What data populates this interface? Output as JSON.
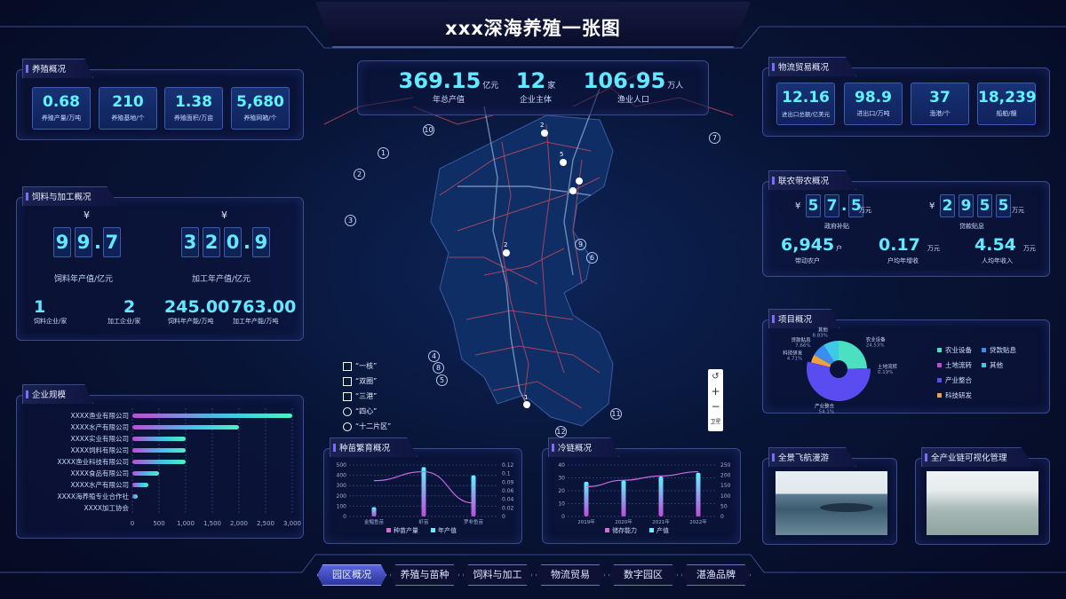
{
  "title": "xxx深海养殖一张图",
  "aquaculture": {
    "title": "养殖概况",
    "cards": [
      {
        "value": "0.68",
        "label": "养殖产量/万吨"
      },
      {
        "value": "210",
        "label": "养殖基地/个"
      },
      {
        "value": "1.38",
        "label": "养殖面积/万亩"
      },
      {
        "value": "5,680",
        "label": "养殖网箱/个"
      }
    ]
  },
  "feed": {
    "title": "饲料与加工概况",
    "currency": "¥",
    "left": {
      "digits": [
        "9",
        "9",
        ".",
        "7"
      ],
      "label": "饲料年产值/亿元"
    },
    "right": {
      "digits": [
        "3",
        "2",
        "0",
        ".",
        "9"
      ],
      "label": "加工年产值/亿元"
    },
    "stats": [
      {
        "value": "1",
        "label": "饲料企业/家"
      },
      {
        "value": "2",
        "label": "加工企业/家"
      },
      {
        "value": "245.00",
        "label": "饲料年产能/万吨"
      },
      {
        "value": "763.00",
        "label": "加工年产能/万吨"
      }
    ]
  },
  "scale": {
    "title": "企业规模"
  },
  "center": {
    "stats": [
      {
        "value": "369.15",
        "unit": "亿元",
        "label": "年总产值"
      },
      {
        "value": "12",
        "unit": "家",
        "label": "企业主体"
      },
      {
        "value": "106.95",
        "unit": "万人",
        "label": "渔业人口"
      }
    ]
  },
  "map": {
    "legend": [
      "“一核”",
      "“双圈”",
      "“三港”",
      "“四心”",
      "“十二片区”"
    ],
    "markers": [
      "1",
      "2",
      "3",
      "4",
      "5",
      "6",
      "7",
      "8",
      "9",
      "10",
      "11",
      "12"
    ],
    "pins": [
      "2",
      "5",
      "2",
      "1"
    ],
    "controls": [
      "↺",
      "+",
      "−",
      "卫星"
    ]
  },
  "logistics": {
    "title": "物流贸易概况",
    "cards": [
      {
        "value": "12.16",
        "label": "进出口总额/亿美元"
      },
      {
        "value": "98.9",
        "label": "进出口/万吨"
      },
      {
        "value": "37",
        "label": "渔港/个"
      },
      {
        "value": "18,239",
        "label": "船舶/艘"
      }
    ]
  },
  "farmers": {
    "title": "联农带农概况",
    "currency": "¥",
    "subsidy": {
      "digits": [
        "5",
        "7",
        ".",
        "5"
      ],
      "unit": "万元",
      "label": "政府补贴"
    },
    "loan": {
      "digits": [
        "2",
        "9",
        "5",
        "5"
      ],
      "unit": "万元",
      "label": "贷款贴息"
    },
    "stats": [
      {
        "value": "6,945",
        "unit": "户",
        "label": "带动农户"
      },
      {
        "value": "0.17",
        "unit": "万元",
        "label": "户均年增收"
      },
      {
        "value": "4.54",
        "unit": "万元",
        "label": "人均年收入"
      }
    ]
  },
  "project": {
    "title": "项目概况",
    "legend": [
      "农业设备",
      "贷款贴息",
      "土地流转",
      "其他",
      "产业整合",
      "科技研发"
    ]
  },
  "seedling": {
    "title": "种苗繁育概况"
  },
  "coldchain": {
    "title": "冷链概况"
  },
  "flight": {
    "title": "全景飞航漫游"
  },
  "chain": {
    "title": "全产业链可视化管理"
  },
  "nav": [
    "园区概况",
    "养殖与苗种",
    "饲料与加工",
    "物流贸易",
    "数字园区",
    "湛渔品牌"
  ],
  "colors": {
    "accent": "#63e9ff",
    "pink": "#d86ad8",
    "purple": "#7a6cff"
  },
  "chart_data": [
    {
      "type": "bar",
      "title": "企业规模",
      "orientation": "horizontal",
      "categories": [
        "XXXX渔业有限公司",
        "XXXX水产有限公司",
        "XXXX实业有限公司",
        "XXXX饲料有限公司",
        "XXXX渔业科技有限公司",
        "XXXX食品有限公司",
        "XXXX水产有限公司",
        "XXXX海养殖专业合作社",
        "XXXX加工协会"
      ],
      "values": [
        3000,
        2000,
        1000,
        1000,
        1000,
        500,
        300,
        100,
        0
      ],
      "xticks": [
        "0",
        "500",
        "1,000",
        "1,500",
        "2,000",
        "2,500",
        "3,000"
      ],
      "xlim": [
        0,
        3000
      ]
    },
    {
      "type": "pie",
      "title": "项目概况",
      "slices": [
        {
          "name": "产业整合",
          "value": 54.1,
          "label": "产业整合 54.1%",
          "color": "#5a4cf0"
        },
        {
          "name": "农业设备",
          "value": 24.53,
          "label": "农业设备 24.53%",
          "color": "#4be0c0"
        },
        {
          "name": "土地流转",
          "value": 0.19,
          "label": "土地流转 0.19%",
          "color": "#c04bd8"
        },
        {
          "name": "科技研发",
          "value": 4.71,
          "label": "科技研发 4.71%",
          "color": "#f0a040"
        },
        {
          "name": "贷款贴息",
          "value": 7.66,
          "label": "贷款贴息 7.66%",
          "color": "#3a8cf0"
        },
        {
          "name": "其他",
          "value": 8.83,
          "label": "其他 8.83%",
          "color": "#3ec9e8"
        }
      ]
    },
    {
      "type": "bar+line",
      "title": "种苗繁育概况",
      "categories": [
        "金鲳鱼苗",
        "虾苗",
        "罗非鱼苗"
      ],
      "series": [
        {
          "name": "种苗产量",
          "type": "bar",
          "values": [
            90,
            480,
            400
          ]
        },
        {
          "name": "年产值",
          "type": "line",
          "values": [
            0.08,
            0.1,
            0.03
          ]
        }
      ],
      "ylim": [
        0,
        500
      ],
      "yticks": [
        "0",
        "100",
        "200",
        "300",
        "400",
        "500"
      ],
      "y2ticks": [
        "0",
        "0.02",
        "0.04",
        "0.06",
        "0.09",
        "0.1",
        "0.12"
      ]
    },
    {
      "type": "bar+line",
      "title": "冷链概况",
      "categories": [
        "2019年",
        "2020年",
        "2021年",
        "2022年"
      ],
      "series": [
        {
          "name": "储存能力",
          "type": "bar",
          "values": [
            27,
            28,
            31,
            34
          ]
        },
        {
          "name": "产值",
          "type": "line",
          "values": [
            140,
            170,
            190,
            210
          ]
        }
      ],
      "ylim": [
        0,
        40
      ],
      "yticks": [
        "0",
        "10",
        "20",
        "30",
        "40"
      ],
      "y2ticks": [
        "0",
        "50",
        "100",
        "150",
        "200",
        "250"
      ]
    }
  ]
}
